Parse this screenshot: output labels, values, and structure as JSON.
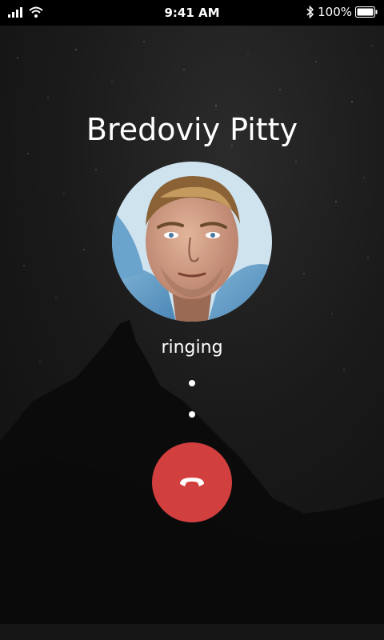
{
  "status_bar": {
    "time": "9:41 AM",
    "battery_percent": "100%",
    "icons": [
      "signal-icon",
      "wifi-icon",
      "bluetooth-icon",
      "battery-icon"
    ]
  },
  "call": {
    "contact_name": "Bredoviy Pitty",
    "status": "ringing",
    "avatar_icon": "contact-photo",
    "end_call_icon": "phone-hangup-icon"
  },
  "colors": {
    "background": "#0c0c0c",
    "end_call": "#d23f3f",
    "text": "#ffffff"
  }
}
